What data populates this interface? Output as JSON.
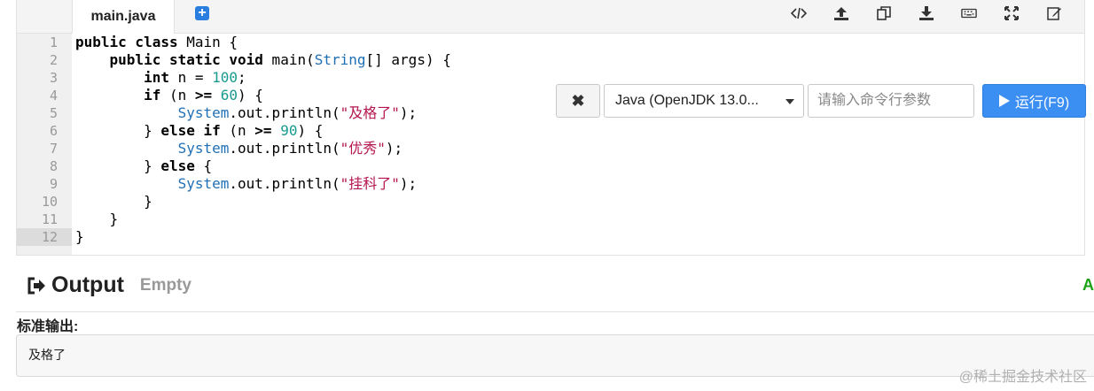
{
  "editor": {
    "file_tab": "main.java",
    "add_tab_symbol": "+",
    "line_numbers": [
      "1",
      "2",
      "3",
      "4",
      "5",
      "6",
      "7",
      "8",
      "9",
      "10",
      "11",
      "12"
    ],
    "code_lines": [
      [
        {
          "t": "kw",
          "v": "public class"
        },
        {
          "t": "p",
          "v": " Main {"
        }
      ],
      [
        {
          "t": "p",
          "v": "    "
        },
        {
          "t": "kw",
          "v": "public static void"
        },
        {
          "t": "p",
          "v": " main("
        },
        {
          "t": "cls",
          "v": "String"
        },
        {
          "t": "p",
          "v": "[] args) {"
        }
      ],
      [
        {
          "t": "p",
          "v": "        "
        },
        {
          "t": "kw",
          "v": "int"
        },
        {
          "t": "p",
          "v": " n = "
        },
        {
          "t": "num",
          "v": "100"
        },
        {
          "t": "p",
          "v": ";"
        }
      ],
      [
        {
          "t": "p",
          "v": "        "
        },
        {
          "t": "kw",
          "v": "if"
        },
        {
          "t": "p",
          "v": " (n "
        },
        {
          "t": "kw",
          "v": ">="
        },
        {
          "t": "p",
          "v": " "
        },
        {
          "t": "num",
          "v": "60"
        },
        {
          "t": "p",
          "v": ") {"
        }
      ],
      [
        {
          "t": "p",
          "v": "            "
        },
        {
          "t": "cls",
          "v": "System"
        },
        {
          "t": "p",
          "v": ".out.println("
        },
        {
          "t": "str",
          "v": "\"及格了\""
        },
        {
          "t": "p",
          "v": ");"
        }
      ],
      [
        {
          "t": "p",
          "v": "        } "
        },
        {
          "t": "kw",
          "v": "else if"
        },
        {
          "t": "p",
          "v": " (n "
        },
        {
          "t": "kw",
          "v": ">="
        },
        {
          "t": "p",
          "v": " "
        },
        {
          "t": "num",
          "v": "90"
        },
        {
          "t": "p",
          "v": ") {"
        }
      ],
      [
        {
          "t": "p",
          "v": "            "
        },
        {
          "t": "cls",
          "v": "System"
        },
        {
          "t": "p",
          "v": ".out.println("
        },
        {
          "t": "str",
          "v": "\"优秀\""
        },
        {
          "t": "p",
          "v": ");"
        }
      ],
      [
        {
          "t": "p",
          "v": "        } "
        },
        {
          "t": "kw",
          "v": "else"
        },
        {
          "t": "p",
          "v": " {"
        }
      ],
      [
        {
          "t": "p",
          "v": "            "
        },
        {
          "t": "cls",
          "v": "System"
        },
        {
          "t": "p",
          "v": ".out.println("
        },
        {
          "t": "str",
          "v": "\"挂科了\""
        },
        {
          "t": "p",
          "v": ");"
        }
      ],
      [
        {
          "t": "p",
          "v": "        }"
        }
      ],
      [
        {
          "t": "p",
          "v": "    }"
        }
      ],
      [
        {
          "t": "p",
          "v": "}"
        }
      ]
    ],
    "current_line": 12
  },
  "toolbar": {
    "icons": [
      "code-icon",
      "upload-icon",
      "copy-icon",
      "download-icon",
      "keyboard-icon",
      "fullscreen-icon",
      "edit-icon"
    ]
  },
  "run": {
    "clear_symbol": "✖",
    "language": "Java (OpenJDK 13.0...",
    "args_placeholder": "请输入命令行参数",
    "run_label": "运行(F9)"
  },
  "output": {
    "title": "Output",
    "status": "Empty",
    "accent_text": "A",
    "accent_color": "#1aa319",
    "stdout_label": "标准输出:",
    "stdout_text": "及格了"
  },
  "watermark": "@稀土掘金技术社区"
}
